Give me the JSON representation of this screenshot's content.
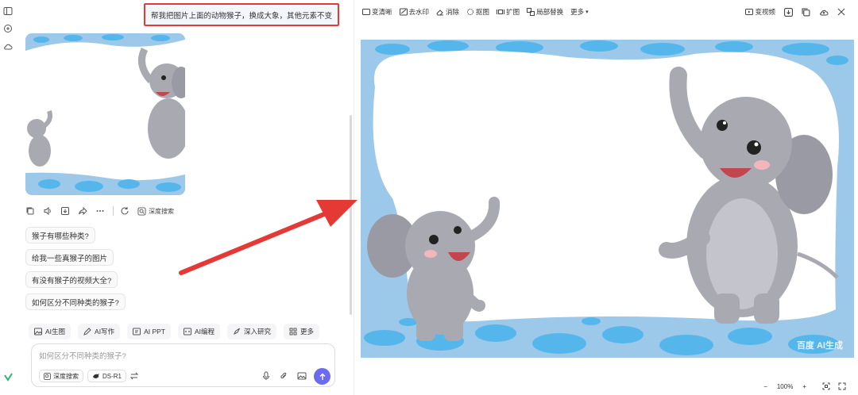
{
  "chat": {
    "user_message": "帮我把图片上面的动物猴子，换成大象，其他元素不变",
    "deep_search_label": "深度搜索",
    "suggestions": [
      "猴子有哪些种类?",
      "给我一些真猴子的图片",
      "有没有猴子的视频大全?",
      "如何区分不同种类的猴子?"
    ],
    "tools": [
      "AI生图",
      "AI写作",
      "AI PPT",
      "AI编程",
      "深入研究",
      "更多"
    ],
    "input_placeholder": "如何区分不同种类的猴子?",
    "deep_search_pill": "深度搜索",
    "model_pill": "DS-R1"
  },
  "preview": {
    "toolbar": [
      "变清晰",
      "去水印",
      "消除",
      "抠图",
      "扩图",
      "局部替换",
      "更多"
    ],
    "to_video": "变视频",
    "zoom": "100%",
    "watermark": "百度 AI生成"
  },
  "colors": {
    "highlight_border": "#e53935",
    "arrow": "#e53935",
    "send_button": "#6b6bf0",
    "bubble_blue": "#55b6ec"
  }
}
